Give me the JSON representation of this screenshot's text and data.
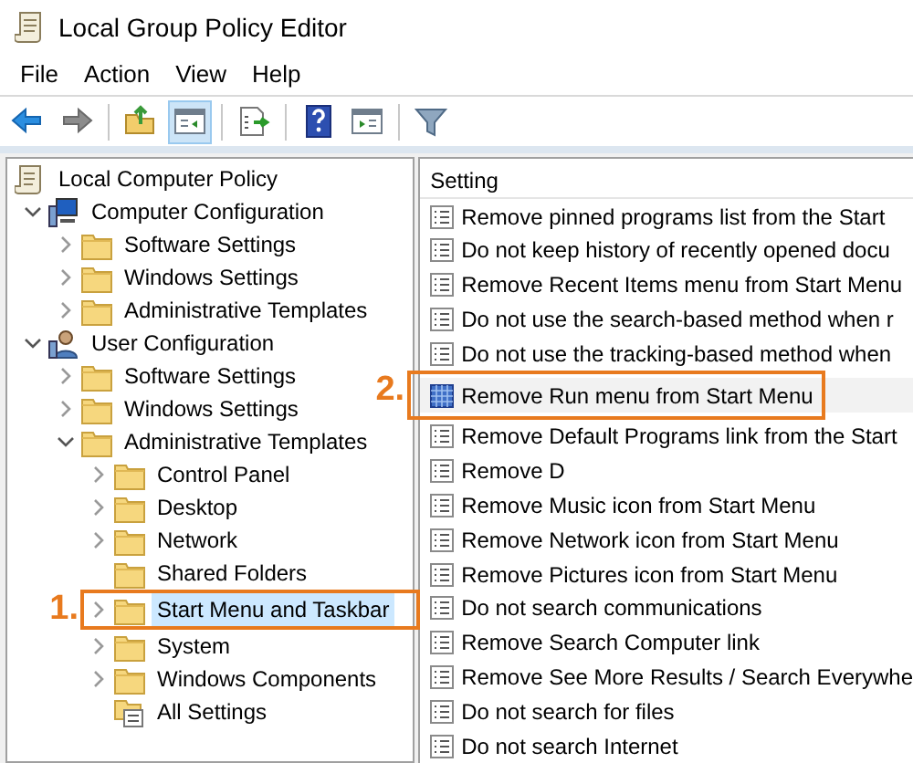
{
  "window": {
    "title": "Local Group Policy Editor"
  },
  "menu": [
    "File",
    "Action",
    "View",
    "Help"
  ],
  "toolbar": [
    {
      "kind": "back",
      "pressed": false
    },
    {
      "kind": "forward",
      "pressed": false
    },
    {
      "kind": "separator"
    },
    {
      "kind": "up",
      "pressed": false
    },
    {
      "kind": "tree",
      "pressed": true
    },
    {
      "kind": "separator"
    },
    {
      "kind": "export",
      "pressed": false
    },
    {
      "kind": "separator"
    },
    {
      "kind": "help",
      "pressed": false
    },
    {
      "kind": "action-pane",
      "pressed": false
    },
    {
      "kind": "separator"
    },
    {
      "kind": "filter",
      "pressed": false
    }
  ],
  "tree": [
    {
      "label": "Local Computer Policy",
      "kind": "policy",
      "selected": false,
      "children": [
        {
          "label": "Computer Configuration",
          "kind": "computer",
          "expanded": true,
          "selected": false,
          "children": [
            {
              "label": "Software Settings",
              "kind": "folder",
              "expanded": false,
              "selected": false
            },
            {
              "label": "Windows Settings",
              "kind": "folder",
              "expanded": false,
              "selected": false
            },
            {
              "label": "Administrative Templates",
              "kind": "folder",
              "expanded": false,
              "selected": false
            }
          ]
        },
        {
          "label": "User Configuration",
          "kind": "user",
          "expanded": true,
          "selected": false,
          "children": [
            {
              "label": "Software Settings",
              "kind": "folder",
              "expanded": false,
              "selected": false
            },
            {
              "label": "Windows Settings",
              "kind": "folder",
              "expanded": false,
              "selected": false
            },
            {
              "label": "Administrative Templates",
              "kind": "folder",
              "expanded": true,
              "selected": false,
              "children": [
                {
                  "label": "Control Panel",
                  "kind": "folder",
                  "expanded": false,
                  "selected": false
                },
                {
                  "label": "Desktop",
                  "kind": "folder",
                  "expanded": false,
                  "selected": false
                },
                {
                  "label": "Network",
                  "kind": "folder",
                  "expanded": false,
                  "selected": false
                },
                {
                  "label": "Shared Folders",
                  "kind": "folder",
                  "selected": false
                },
                {
                  "label": "Start Menu and Taskbar",
                  "kind": "folder",
                  "expanded": false,
                  "selected": true,
                  "callout": "1."
                },
                {
                  "label": "System",
                  "kind": "folder",
                  "expanded": false,
                  "selected": false
                },
                {
                  "label": "Windows Components",
                  "kind": "folder",
                  "expanded": false,
                  "selected": false
                },
                {
                  "label": "All Settings",
                  "kind": "settings",
                  "selected": false
                }
              ]
            }
          ]
        }
      ]
    }
  ],
  "settings": {
    "column": "Setting",
    "rows": [
      {
        "label": "Remove pinned programs list from the Start",
        "selected": false
      },
      {
        "label": "Do not keep history of recently opened docu",
        "selected": false
      },
      {
        "label": "Remove Recent Items menu from Start Menu",
        "selected": false
      },
      {
        "label": "Do not use the search-based method when r",
        "selected": false
      },
      {
        "label": "Do not use the tracking-based method when",
        "selected": false
      },
      {
        "label": "Remove Run menu from Start Menu",
        "selected": true,
        "callout": "2."
      },
      {
        "label": "Remove Default Programs link from the Start",
        "selected": false
      },
      {
        "label": "Remove D",
        "selected": false
      },
      {
        "label": "Remove Music icon from Start Menu",
        "selected": false
      },
      {
        "label": "Remove Network icon from Start Menu",
        "selected": false
      },
      {
        "label": "Remove Pictures icon from Start Menu",
        "selected": false
      },
      {
        "label": "Do not search communications",
        "selected": false
      },
      {
        "label": "Remove Search Computer link",
        "selected": false
      },
      {
        "label": "Remove See More Results / Search Everywhe",
        "selected": false
      },
      {
        "label": "Do not search for files",
        "selected": false
      },
      {
        "label": "Do not search Internet",
        "selected": false
      }
    ]
  }
}
